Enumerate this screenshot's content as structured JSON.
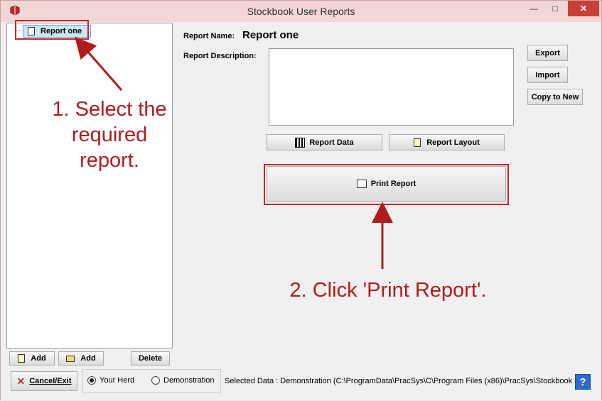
{
  "window": {
    "title": "Stockbook User Reports",
    "close_glyph": "✕",
    "min_glyph": "—",
    "max_glyph": "□"
  },
  "tree": {
    "items": [
      {
        "label": "Report one",
        "icon": "document-icon"
      }
    ]
  },
  "form": {
    "report_name_label": "Report Name:",
    "report_name_value": "Report one",
    "report_description_label": "Report Description:",
    "report_description_value": ""
  },
  "buttons": {
    "export": "Export",
    "import": "Import",
    "copy_to_new": "Copy to New",
    "report_data": "Report Data",
    "report_layout": "Report Layout",
    "print_report": "Print Report",
    "add_report": "Add",
    "add_folder": "Add",
    "delete": "Delete",
    "cancel_exit": "Cancel/Exit"
  },
  "annotations": {
    "step1": "1. Select the required report.",
    "step1_lines": [
      "1. Select the",
      "required",
      "report."
    ],
    "step2": "2. Click 'Print Report'."
  },
  "data_source": {
    "options": [
      "Your Herd",
      "Demonstration"
    ],
    "selected": "Your Herd"
  },
  "status": {
    "selected_data": "Selected Data : Demonstration (C:\\ProgramData\\PracSys\\C\\Program Files (x86)\\PracSys\\Stockbook CL"
  },
  "help": {
    "glyph": "?"
  },
  "colors": {
    "annotation": "#b01c1c",
    "titlebar": "#f3d6d6",
    "close_button": "#c7403a",
    "help_button": "#2a6bd1"
  }
}
